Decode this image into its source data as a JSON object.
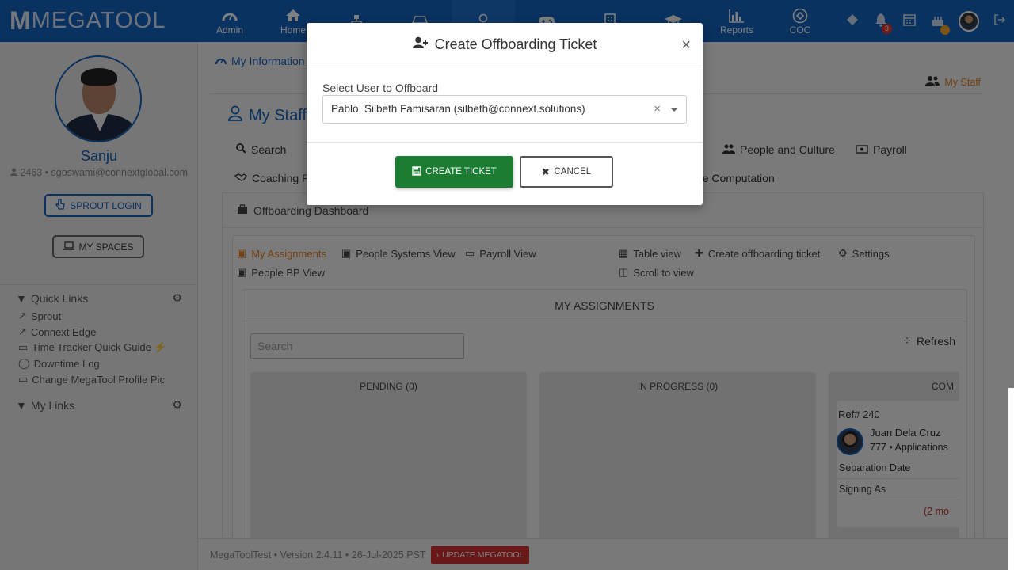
{
  "app": {
    "logo_letter": "M",
    "logo_text": "MEGATOOL"
  },
  "topnav": {
    "items": [
      {
        "label": "Admin",
        "icon": "dashboard-icon"
      },
      {
        "label": "Home",
        "icon": "home-icon"
      },
      {
        "label": "",
        "icon": "org-chart-icon"
      },
      {
        "label": "",
        "icon": "drive-icon"
      },
      {
        "label": "",
        "icon": "user-icon"
      },
      {
        "label": "",
        "icon": "gamepad-icon"
      },
      {
        "label": "",
        "icon": "building-icon"
      },
      {
        "label": "",
        "icon": "graduation-cap-icon"
      },
      {
        "label": "Reports",
        "icon": "bar-chart-icon"
      },
      {
        "label": "COC",
        "icon": "coc-icon"
      }
    ],
    "notification_count": "3"
  },
  "sidebar": {
    "user_name": "Sanju",
    "user_info": "2463 • sgoswami@connextglobal.com",
    "sprout_login": "SPROUT LOGIN",
    "my_spaces": "MY SPACES",
    "quick_links_title": "Quick Links",
    "quick_links": [
      {
        "label": "Sprout",
        "icon": "external-link-icon"
      },
      {
        "label": "Connext Edge",
        "icon": "external-link-icon"
      },
      {
        "label": "Time Tracker Quick Guide ⚡",
        "icon": "drive-icon"
      },
      {
        "label": "Downtime Log",
        "icon": "user-icon"
      },
      {
        "label": "Change MegaTool Profile Pic",
        "icon": "drive-icon"
      }
    ],
    "my_links_title": "My Links"
  },
  "main": {
    "breadcrumb": "My Information",
    "my_staff_link": "My Staff",
    "page_title": "My Staff",
    "tabs": {
      "search": "Search",
      "people_culture": "People and Culture",
      "payroll": "Payroll",
      "coaching": "Coaching Re",
      "computation": "ate Computation"
    },
    "panel_title": "Offboarding Dashboard",
    "views": {
      "my_assignments": "My Assignments",
      "people_systems": "People Systems View",
      "payroll_view": "Payroll View",
      "people_bp": "People BP View",
      "table_view": "Table view",
      "create_ticket": "Create offboarding ticket",
      "settings": "Settings",
      "scroll_view": "Scroll to view"
    },
    "assignments_title": "MY ASSIGNMENTS",
    "search_placeholder": "Search",
    "refresh": "Refresh",
    "columns": {
      "pending": "PENDING (0)",
      "in_progress": "IN PROGRESS (0)",
      "completed": "COM"
    },
    "card": {
      "ref": "Ref# 240",
      "name": "Juan Dela Cruz",
      "sub": "777 • Applications",
      "separation": "Separation Date",
      "signing": "Signing As",
      "months": "(2 mo"
    }
  },
  "footer": {
    "version": "MegaToolTest • Version 2.4.11 • 26-Jul-2025 PST",
    "update": "UPDATE MEGATOOL"
  },
  "modal": {
    "title": "Create Offboarding Ticket",
    "select_label": "Select User to Offboard",
    "selected_user": "Pablo, Silbeth Famisaran (silbeth@connext.solutions)",
    "create_button": "CREATE TICKET",
    "cancel_button": "CANCEL"
  },
  "colors": {
    "primary": "#1565c0",
    "accent": "#e67e22",
    "success": "#1b7d32",
    "danger": "#d32f2f"
  }
}
